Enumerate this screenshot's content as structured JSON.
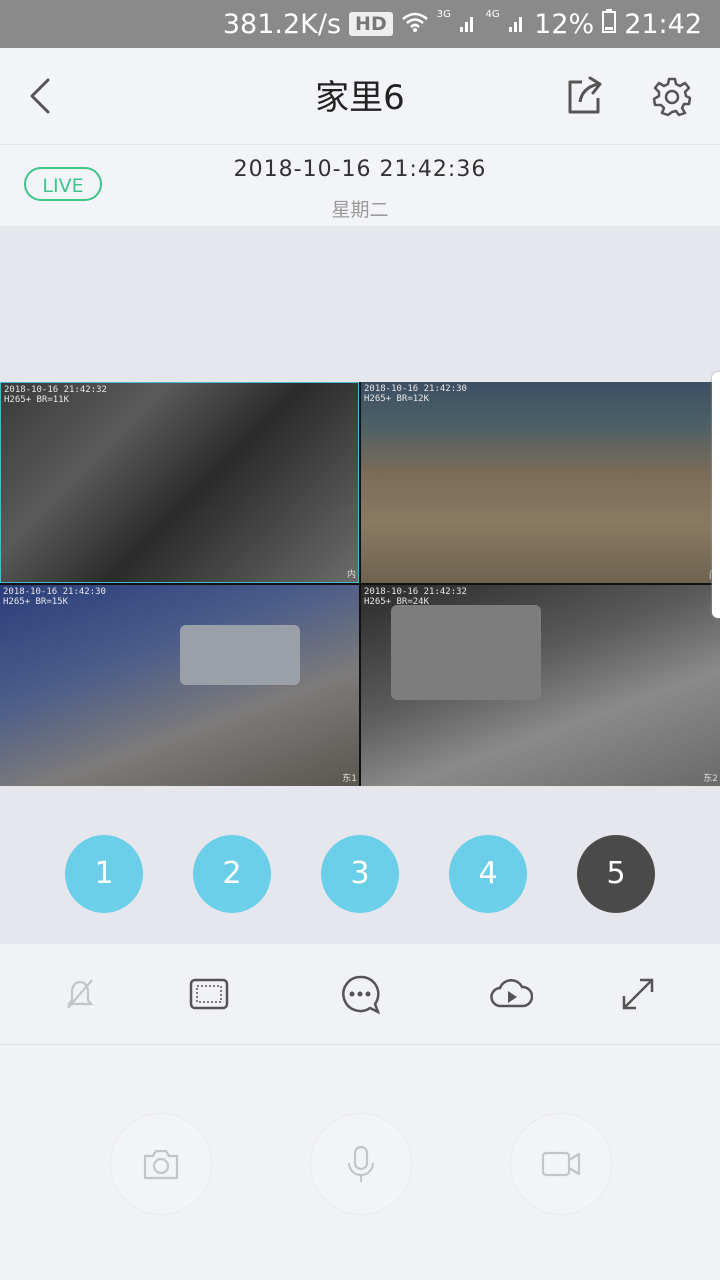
{
  "status_bar": {
    "speed": "381.2K/s",
    "hd": "HD",
    "net_3g": "3G",
    "net_4g": "4G",
    "battery": "12%",
    "time": "21:42"
  },
  "header": {
    "title": "家里6",
    "icons": [
      "back-icon",
      "share-icon",
      "settings-icon"
    ]
  },
  "info": {
    "live": "LIVE",
    "datetime": "2018-10-16  21:42:36",
    "weekday": "星期二"
  },
  "cameras": [
    {
      "osd_line1": "2018-10-16 21:42:32",
      "osd_line2": "H265+ BR=11K",
      "label": "内"
    },
    {
      "osd_line1": "2018-10-16 21:42:30",
      "osd_line2": "H265+ BR=12K",
      "label": "门"
    },
    {
      "osd_line1": "2018-10-16 21:42:30",
      "osd_line2": "H265+ BR=15K",
      "label": "东1"
    },
    {
      "osd_line1": "2018-10-16 21:42:32",
      "osd_line2": "H265+ BR=24K",
      "label": "东2"
    }
  ],
  "channels": [
    {
      "label": "1"
    },
    {
      "label": "2"
    },
    {
      "label": "3"
    },
    {
      "label": "4"
    },
    {
      "label": "5",
      "active": true
    }
  ],
  "toolbar": [
    "mute-icon",
    "aspect-ratio-icon",
    "message-icon",
    "cloud-playback-icon",
    "fullscreen-icon"
  ],
  "actions": [
    "snapshot-icon",
    "microphone-icon",
    "record-video-icon"
  ],
  "colors": {
    "live_green": "#3fc48a",
    "channel_blue": "#6bcfea",
    "channel_active": "#4a4a4a"
  }
}
